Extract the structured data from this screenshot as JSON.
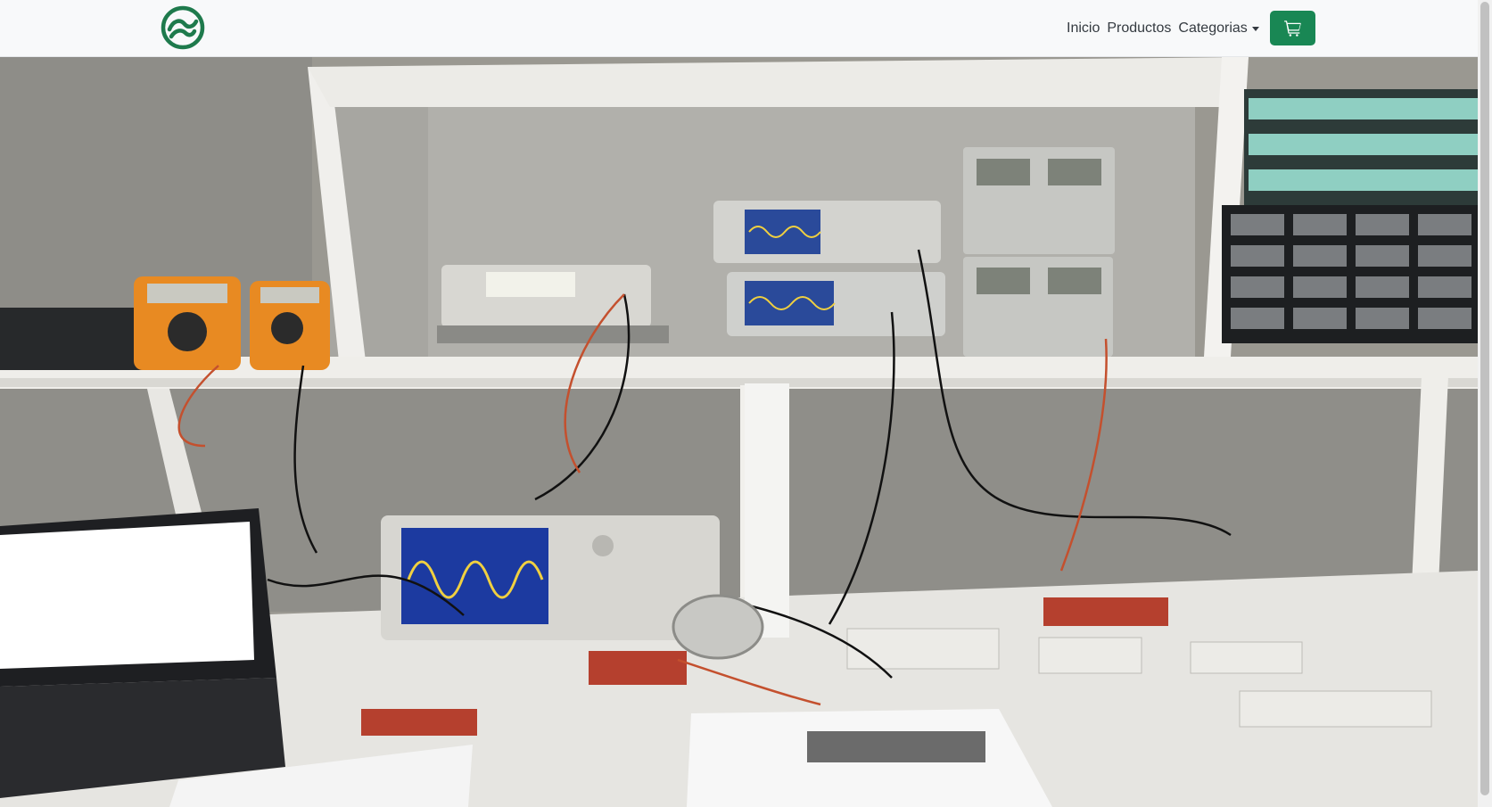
{
  "navbar": {
    "logo_icon": "university-logo-icon",
    "brand_color": "#1e7a4c",
    "links": [
      {
        "label": "Inicio"
      },
      {
        "label": "Productos"
      },
      {
        "label": "Categorias"
      }
    ],
    "cart_icon": "cart-icon",
    "cart_color": "#198754"
  },
  "hero": {
    "image_subject": "electronics-lab-bench"
  }
}
